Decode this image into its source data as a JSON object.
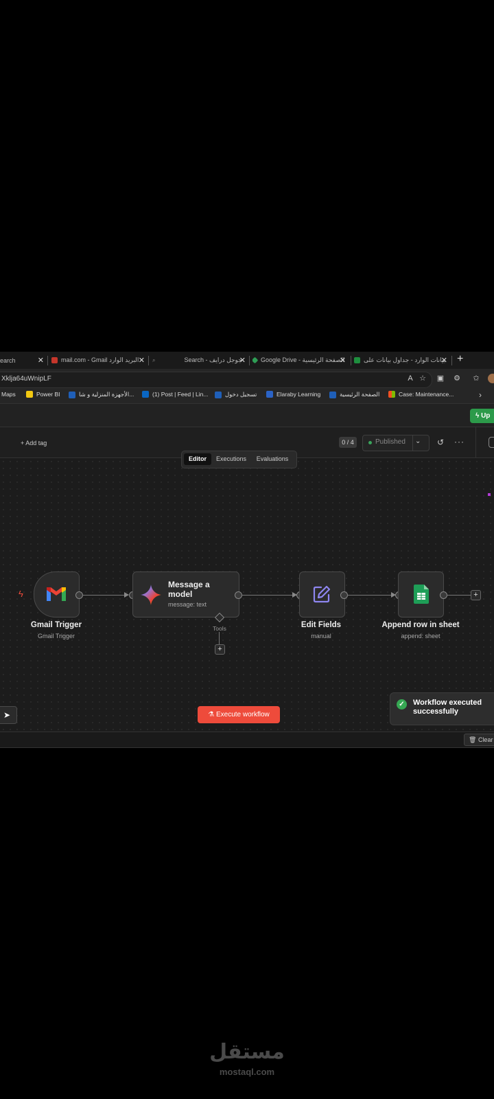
{
  "browser": {
    "tabs": [
      {
        "label": "earch"
      },
      {
        "label": "mail.com - Gmail البريد الوارد"
      },
      {
        "label": "Search - جوجل درايف"
      },
      {
        "label": "Google Drive - الصفحة الرئيسية"
      },
      {
        "label": "بيانات الوارد - جداول بيانات على"
      }
    ],
    "new_tab": "+",
    "url": "Xklja64uWnipLF",
    "bookmarks": [
      {
        "label": "Maps"
      },
      {
        "label": "Power BI"
      },
      {
        "label": "الأجهزة المنزلية و شا..."
      },
      {
        "label": "(1) Post | Feed | Lin..."
      },
      {
        "label": "تسجيل دخول"
      },
      {
        "label": "Elaraby Learning"
      },
      {
        "label": "الصفحة الرئيسية"
      },
      {
        "label": "Case: Maintenance..."
      }
    ]
  },
  "app": {
    "upgrade_label": "Up",
    "add_tag": "+ Add tag",
    "counter": "0 / 4",
    "published": "Published",
    "view_tabs": [
      {
        "label": "Editor"
      },
      {
        "label": "Executions"
      },
      {
        "label": "Evaluations"
      }
    ]
  },
  "workflow": {
    "nodes": [
      {
        "title": "Gmail Trigger",
        "subtitle": "Gmail Trigger",
        "icon": "gmail-icon"
      },
      {
        "title": "Message a model",
        "subtitle": "message: text",
        "icon": "gemini-icon"
      },
      {
        "title": "Edit Fields",
        "subtitle": "manual",
        "icon": "edit-icon"
      },
      {
        "title": "Append row in sheet",
        "subtitle": "append: sheet",
        "icon": "sheets-icon"
      }
    ],
    "tools_label": "Tools",
    "execute_label": "Execute workflow",
    "toast": "Workflow executed successfully"
  },
  "bottom": {
    "clear_label": "Clear"
  },
  "watermark": {
    "arabic": "مستقل",
    "latin": "mostaql.com"
  },
  "colors": {
    "accent_red": "#ee4b3b",
    "success_green": "#36a853"
  }
}
